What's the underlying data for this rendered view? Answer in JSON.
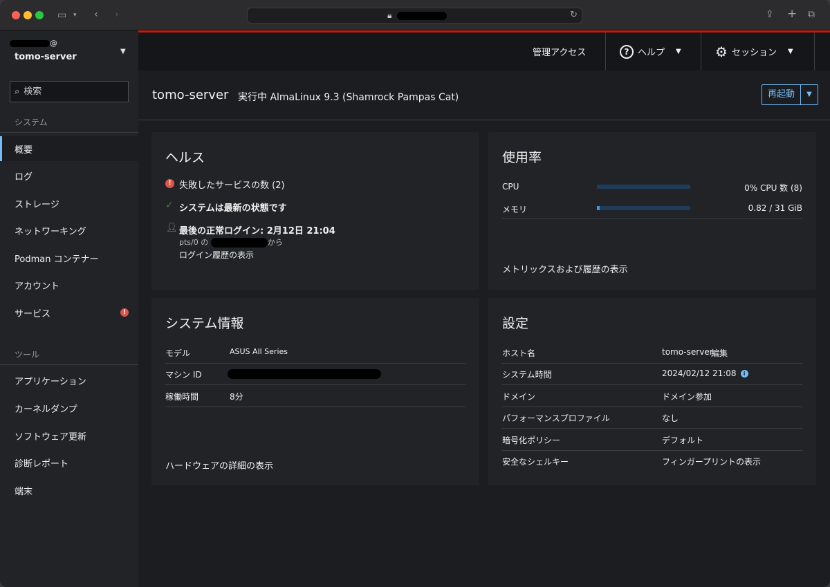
{
  "browser": {
    "reload_icon": "reload-icon",
    "lock_icon": "lock-icon"
  },
  "header": {
    "host_user_suffix": "@",
    "host_name": "tomo-server",
    "admin_access": "管理アクセス",
    "help_label": "ヘルプ",
    "session_label": "セッション"
  },
  "sidebar": {
    "search_placeholder": "検索",
    "system_label": "システム",
    "tools_label": "ツール",
    "system_items": [
      {
        "label": "概要"
      },
      {
        "label": "ログ"
      },
      {
        "label": "ストレージ"
      },
      {
        "label": "ネットワーキング"
      },
      {
        "label": "Podman コンテナー"
      },
      {
        "label": "アカウント"
      },
      {
        "label": "サービス"
      }
    ],
    "tool_items": [
      {
        "label": "アプリケーション"
      },
      {
        "label": "カーネルダンプ"
      },
      {
        "label": "ソフトウェア更新"
      },
      {
        "label": "診断レポート"
      },
      {
        "label": "端末"
      }
    ],
    "service_badge": "!"
  },
  "page": {
    "host": "tomo-server",
    "status": "実行中 AlmaLinux 9.3 (Shamrock Pampas Cat)",
    "restart_label": "再起動"
  },
  "health": {
    "title": "ヘルス",
    "failed_services": "失敗したサービスの数 (2)",
    "up_to_date": "システムは最新の状態です",
    "last_login": "最後の正常ログイン: 2月12日 21:04",
    "login_from_prefix": "pts/0 の",
    "login_from_suffix": "から",
    "login_history_link": "ログイン履歴の表示"
  },
  "usage": {
    "title": "使用率",
    "cpu_label": "CPU",
    "cpu_value": "0% CPU 数 (8)",
    "cpu_fraction": 0.0,
    "mem_label": "メモリ",
    "mem_value": "0.82 / 31 GiB",
    "mem_fraction": 0.026,
    "metrics_link": "メトリックスおよび履歴の表示"
  },
  "sysinfo": {
    "title": "システム情報",
    "rows": [
      {
        "label": "モデル",
        "value": "ASUS All Series"
      },
      {
        "label": "マシン ID",
        "value": ""
      },
      {
        "label": "稼働時間",
        "value": "8分"
      }
    ],
    "hardware_link": "ハードウェアの詳細の表示"
  },
  "config": {
    "title": "設定",
    "hostname_label": "ホスト名",
    "hostname_value": "tomo-server",
    "hostname_edit": "編集",
    "time_label": "システム時間",
    "time_value": "2024/02/12 21:08",
    "domain_label": "ドメイン",
    "domain_value": "ドメイン参加",
    "perf_label": "パフォーマンスプロファイル",
    "perf_value": "なし",
    "crypto_label": "暗号化ポリシー",
    "crypto_value": "デフォルト",
    "ssh_label": "安全なシェルキー",
    "ssh_value": "フィンガープリントの表示"
  },
  "colors": {
    "accent": "#73bcf7",
    "danger": "#e0554b",
    "success": "#3e8635",
    "brand_red": "#c9190b"
  }
}
